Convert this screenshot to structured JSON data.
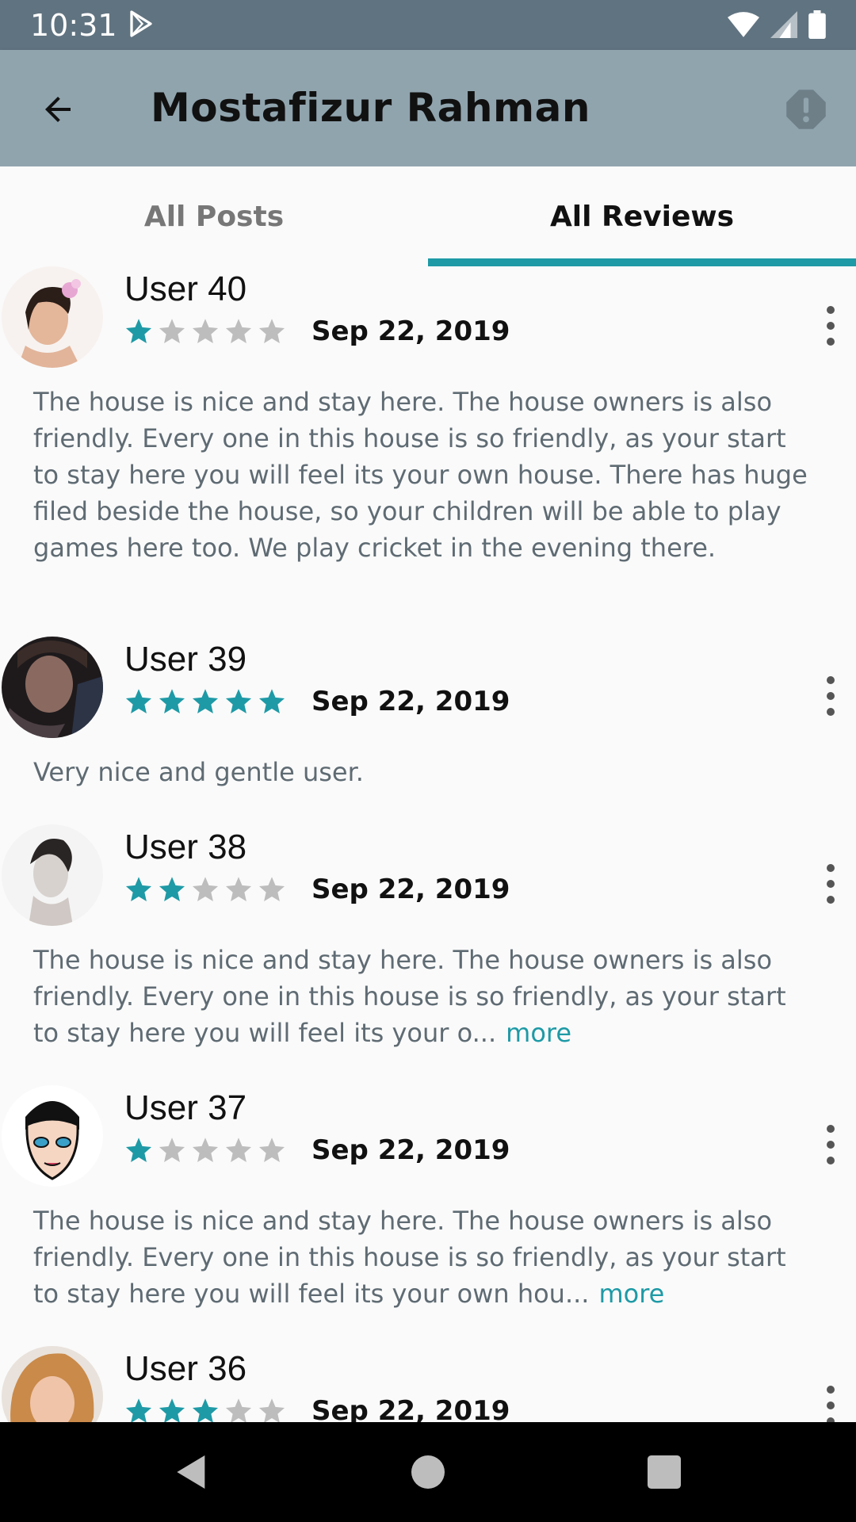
{
  "status_bar": {
    "time": "10:31"
  },
  "app_bar": {
    "title": "Mostafizur Rahman"
  },
  "tabs": [
    {
      "label": "All Posts",
      "selected": false
    },
    {
      "label": "All Reviews",
      "selected": true
    }
  ],
  "reviews": [
    {
      "name": "User 40",
      "rating": 1,
      "date": "Sep 22, 2019",
      "text": "The house is nice and stay here. The house owners is also friendly. Every one in this house is so friendly, as your start to stay here you will feel its your own house. There has huge filed beside the house, so your children will be able to play games here too. We play cricket in the evening there.",
      "more": ""
    },
    {
      "name": "User 39",
      "rating": 5,
      "date": "Sep 22, 2019",
      "text": "Very nice and gentle user.",
      "more": ""
    },
    {
      "name": "User 38",
      "rating": 2,
      "date": "Sep 22, 2019",
      "text": "The house is nice and stay here. The house owners is also friendly. Every one in this house is so friendly, as your start to stay here you will feel its your o...",
      "more": "more"
    },
    {
      "name": "User 37",
      "rating": 1,
      "date": "Sep 22, 2019",
      "text": "The house is nice and stay here. The house owners is also friendly. Every one in this house is so friendly, as your start to stay here you will feel its your own hou...",
      "more": "more"
    },
    {
      "name": "User 36",
      "rating": 3,
      "date": "Sep 22, 2019",
      "text": "",
      "more": ""
    }
  ],
  "colors": {
    "accent": "#1e9aa6",
    "star_off": "#bdbdbd",
    "app_bar": "#90a4ae",
    "status_bar": "#607380"
  },
  "icons": [
    "back-arrow-icon",
    "report-icon",
    "more-vert-icon",
    "star-icon",
    "nav-back-icon",
    "nav-home-icon",
    "nav-recents-icon"
  ]
}
